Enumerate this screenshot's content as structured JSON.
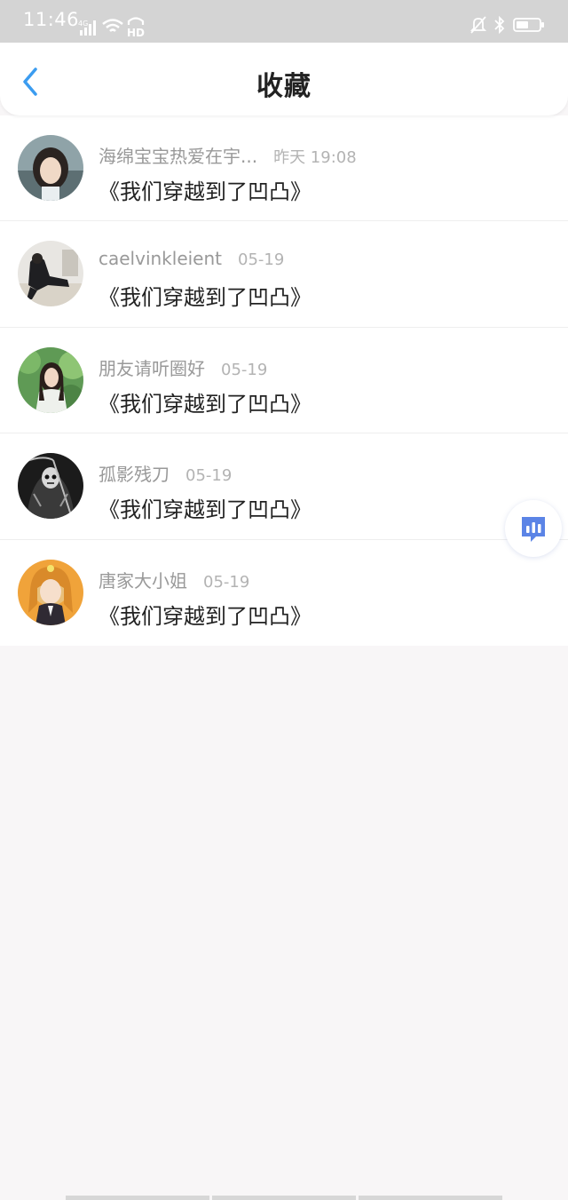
{
  "status_bar": {
    "time": "11:46",
    "network": "4G",
    "hd": "HD"
  },
  "header": {
    "title": "收藏",
    "back_icon": "chevron-left-icon"
  },
  "items": [
    {
      "author": "海绵宝宝热爱在宇...",
      "date": "昨天 19:08",
      "story": "《我们穿越到了凹凸》"
    },
    {
      "author": "caelvinkleient",
      "date": "05-19",
      "story": "《我们穿越到了凹凸》"
    },
    {
      "author": "朋友请听圈好",
      "date": "05-19",
      "story": "《我们穿越到了凹凸》"
    },
    {
      "author": "孤影残刀",
      "date": "05-19",
      "story": "《我们穿越到了凹凸》"
    },
    {
      "author": "唐家大小姐",
      "date": "05-19",
      "story": "《我们穿越到了凹凸》"
    }
  ],
  "float_button": {
    "icon": "chart-bubble-icon"
  },
  "colors": {
    "accent": "#3b9cf0",
    "title": "#222222",
    "meta": "#999999",
    "background": "#f8f6f7"
  }
}
